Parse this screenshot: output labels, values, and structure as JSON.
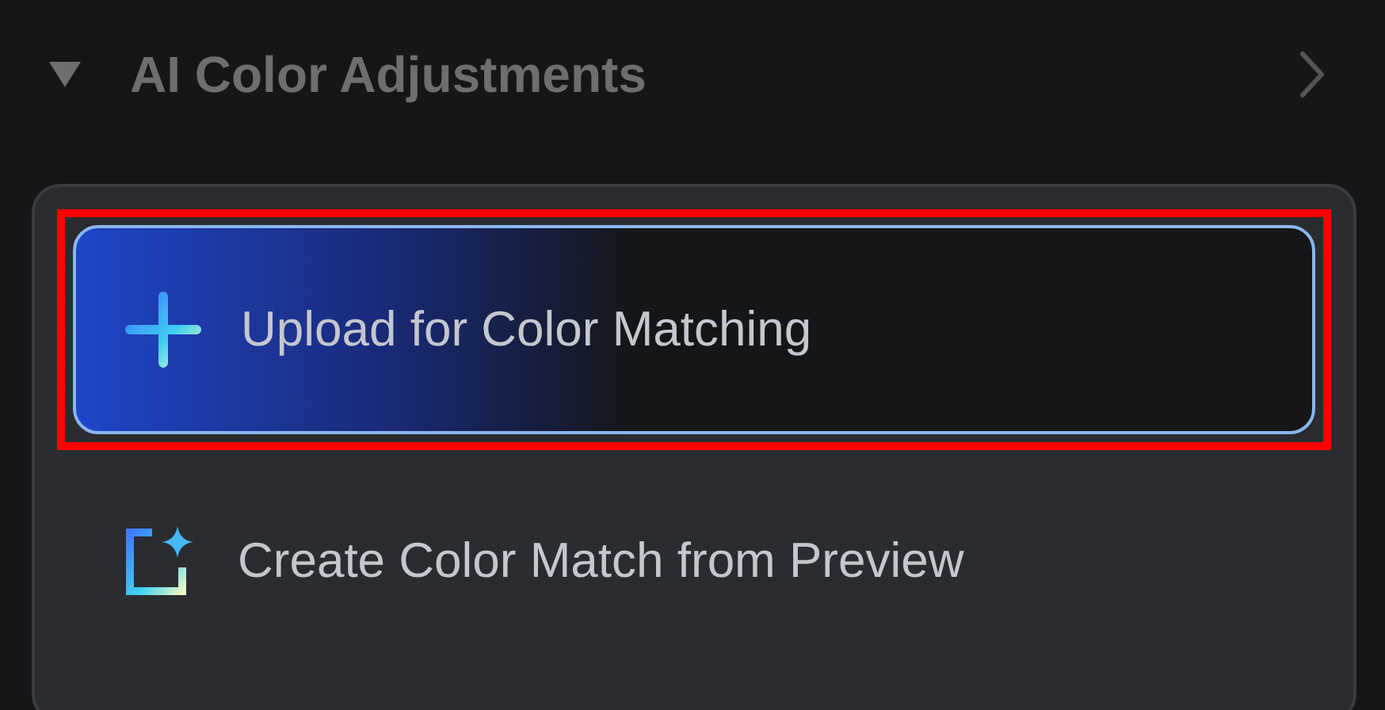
{
  "section": {
    "title": "AI Color Adjustments",
    "expanded": true
  },
  "actions": [
    {
      "kind": "upload",
      "label": "Upload for Color Matching",
      "highlighted": true
    },
    {
      "kind": "create",
      "label": "Create Color Match from Preview",
      "highlighted": false
    }
  ]
}
